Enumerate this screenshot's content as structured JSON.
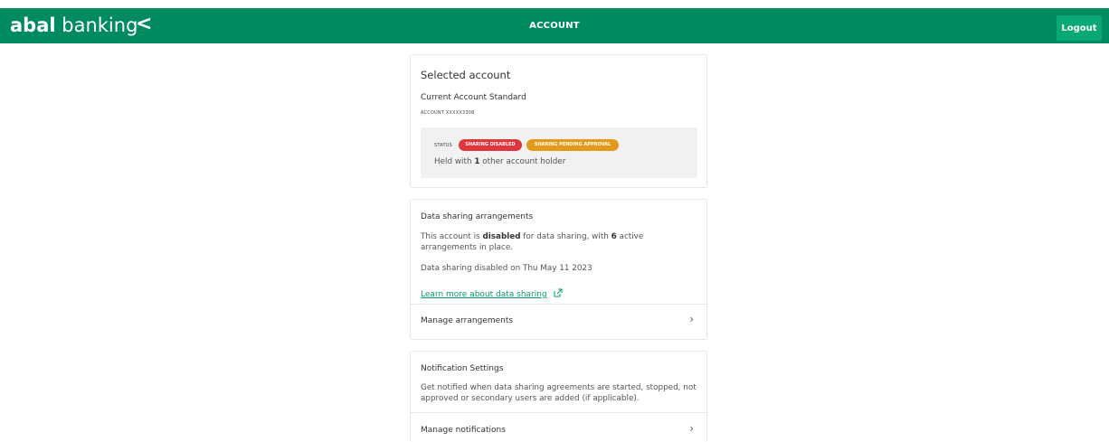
{
  "header": {
    "brand_bold": "abal",
    "brand_light": " banking",
    "back_glyph": "<",
    "title": "ACCOUNT",
    "logout_label": "Logout"
  },
  "selected_account": {
    "heading": "Selected account",
    "account_name": "Current Account Standard",
    "account_number": "ACCOUNT XXXXX3308",
    "status_label": "STATUS",
    "badges": [
      "SHARING DISABLED",
      "SHARING PENDING APPROVAL"
    ],
    "held_prefix": "Held with ",
    "held_count": "1",
    "held_suffix": " other account holder"
  },
  "data_sharing": {
    "heading": "Data sharing arrangements",
    "desc_prefix": "This account is ",
    "desc_status": "disabled",
    "desc_middle": " for data sharing, with ",
    "desc_count": "6",
    "desc_suffix": " active arrangements in place.",
    "disabled_on": "Data sharing disabled on Thu May 11 2023",
    "learn_more": "Learn more about data sharing",
    "manage_label": "Manage arrangements"
  },
  "notifications": {
    "heading": "Notification Settings",
    "desc": "Get notified when data sharing agreements are started, stopped, not approved or secondary users are added (if applicable).",
    "manage_label": "Manage notifications"
  },
  "colors": {
    "brand_green": "#008a61",
    "logout_green": "#0aa874",
    "badge_disabled": "#e0363d",
    "badge_pending": "#e39a1b",
    "link_green": "#0a9a68"
  },
  "icons": {
    "back": "chevron-left-icon",
    "row_arrow": "chevron-right-icon",
    "external": "external-link-icon"
  }
}
